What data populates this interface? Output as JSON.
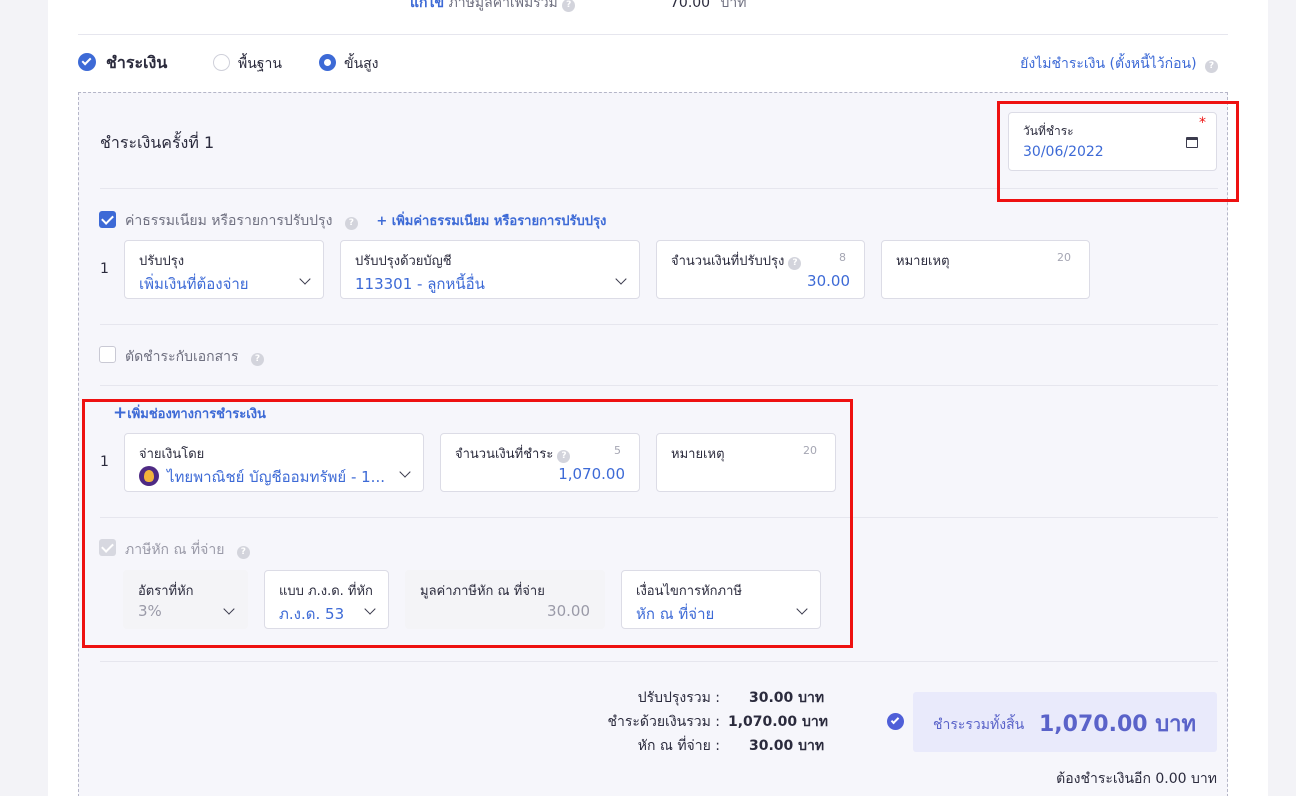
{
  "top_partial": {
    "link": "แก้ไข",
    "label": "ภาษีมูลค่าเพิ่มรวม",
    "value": "70.00",
    "unit": "บาท"
  },
  "payment_header": {
    "title": "ชำระเงิน",
    "mode_basic": "พื้นฐาน",
    "mode_advanced": "ขั้นสูง",
    "unpaid_link": "ยังไม่ชำระเงิน (ตั้งหนี้ไว้ก่อน)"
  },
  "installment": {
    "title": "ชำระเงินครั้งที่ 1",
    "date_label": "วันที่ชำระ",
    "date_required": "*",
    "date_value": "30/06/2022"
  },
  "fees": {
    "checkbox_label": "ค่าธรรมเนียม หรือรายการปรับปรุง",
    "add_link": "+ เพิ่มค่าธรรมเนียม หรือรายการปรับปรุง",
    "row_num": "1",
    "adjust_label": "ปรับปรุง",
    "adjust_value": "เพิ่มเงินที่ต้องจ่าย",
    "account_label": "ปรับปรุงด้วยบัญชี",
    "account_value": "113301 - ลูกหนี้อื่น",
    "amount_label": "จำนวนเงินที่ปรับปรุง",
    "amount_count": "8",
    "amount_value": "30.00",
    "note_label": "หมายเหตุ",
    "note_count": "20"
  },
  "offset": {
    "checkbox_label": "ตัดชำระกับเอกสาร"
  },
  "channel": {
    "add_link": "เพิ่มช่องทางการชำระเงิน",
    "row_num": "1",
    "payby_label": "จ่ายเงินโดย",
    "payby_value": "ไทยพาณิชย์ บัญชีออมทรัพย์ - 1...",
    "amount_label": "จำนวนเงินที่ชำระ",
    "amount_count": "5",
    "amount_value": "1,070.00",
    "note_label": "หมายเหตุ",
    "note_count": "20"
  },
  "wht": {
    "checkbox_label": "ภาษีหัก ณ ที่จ่าย",
    "rate_label": "อัตราที่หัก",
    "rate_value": "3%",
    "form_label": "แบบ ภ.ง.ด. ที่หัก",
    "form_value": "ภ.ง.ด. 53",
    "value_label": "มูลค่าภาษีหัก ณ ที่จ่าย",
    "value_value": "30.00",
    "cond_label": "เงื่อนไขการหักภาษี",
    "cond_value": "หัก ณ ที่จ่าย"
  },
  "summary": {
    "adjust_label": "ปรับปรุงรวม :",
    "adjust_value": "30.00 บาท",
    "paid_label": "ชำระด้วยเงินรวม :",
    "paid_value": "1,070.00 บาท",
    "wht_label": "หัก ณ ที่จ่าย :",
    "wht_value": "30.00 บาท",
    "total_label": "ชำระรวมทั้งสิ้น",
    "total_value": "1,070.00 บาท",
    "remaining": "ต้องชำระเงินอีก 0.00 บาท"
  },
  "colors": {
    "accent": "#3d6ad6",
    "highlight": "#ee1111",
    "total_bg": "#e9eafb"
  }
}
